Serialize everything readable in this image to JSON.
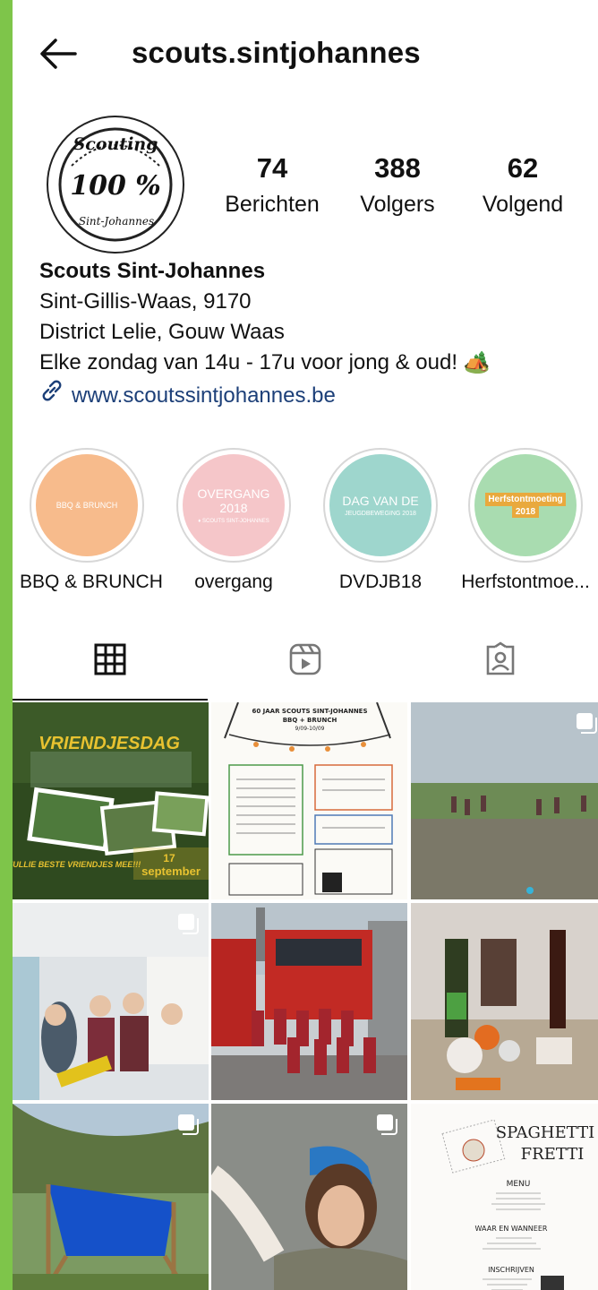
{
  "header": {
    "username": "scouts.sintjohannes"
  },
  "avatar": {
    "line1": "Scouting",
    "line2": "100 %",
    "line3": "Sint-Johannes"
  },
  "stats": [
    {
      "value": "74",
      "label": "Berichten"
    },
    {
      "value": "388",
      "label": "Volgers"
    },
    {
      "value": "62",
      "label": "Volgend"
    }
  ],
  "bio": {
    "name": "Scouts Sint-Johannes",
    "line1": "Sint-Gillis-Waas, 9170",
    "line2": "District Lelie, Gouw Waas",
    "line3": "Elke zondag van 14u - 17u voor jong & oud! 🏕️",
    "link": "www.scoutssintjohannes.be"
  },
  "highlights": [
    {
      "label": "BBQ & BRUNCH",
      "cover_text": "BBQ & BRUNCH",
      "cover_subtext": "",
      "color": "#f7bb8c"
    },
    {
      "label": "overgang",
      "cover_text": "OVERGANG 2018",
      "cover_subtext": "♦ SCOUTS SINT-JOHANNES",
      "color": "#f5c6c9"
    },
    {
      "label": "DVDJB18",
      "cover_text": "DAG VAN DE",
      "cover_subtext": "JEUGDBEWEGING 2018",
      "color": "#9ed6cd"
    },
    {
      "label": "Herfstontmoe...",
      "cover_text": "Herfstontmoeting",
      "cover_subtext": "2018",
      "color": "#a9dcb0"
    }
  ],
  "tabs": [
    {
      "icon": "grid-icon",
      "active": true
    },
    {
      "icon": "reels-icon",
      "active": false
    },
    {
      "icon": "tagged-icon",
      "active": false
    }
  ],
  "posts": [
    {
      "title": "VRIENDJESDAG",
      "text1": "NEEM JULLIE BESTE VRIENDJES MEE!!!",
      "text2": "17",
      "text3": "september"
    },
    {
      "title": "60 JAAR SCOUTS SINT-JOHANNES",
      "text1": "BBQ + BRUNCH",
      "text2": "9/09-10/09"
    },
    {
      "title": ""
    },
    {
      "title": ""
    },
    {
      "title": ""
    },
    {
      "title": ""
    },
    {
      "title": ""
    },
    {
      "title": ""
    },
    {
      "title": "SPAGHETTI",
      "text1": "FRETTI",
      "text2": "MENU",
      "text3": "WAAR EN WANNEER",
      "text4": "INSCHRIJVEN"
    }
  ],
  "colors": {
    "accent_green": "#7ec54a",
    "link": "#1c3f78"
  }
}
